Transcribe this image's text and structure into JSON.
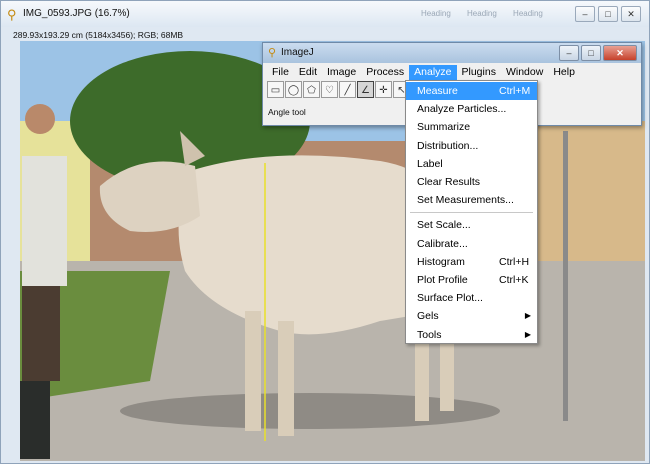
{
  "image_window": {
    "title": "IMG_0593.JPG (16.7%)",
    "info": "289.93x193.29 cm (5184x3456); RGB; 68MB",
    "blurred_tabs": "Heading   Heading   Heading",
    "controls": {
      "minimize": "–",
      "maximize": "□",
      "close": "✕"
    }
  },
  "imagej": {
    "title": "ImageJ",
    "controls": {
      "minimize": "–",
      "maximize": "□",
      "close": "✕"
    },
    "menus": [
      {
        "label": "File"
      },
      {
        "label": "Edit"
      },
      {
        "label": "Image"
      },
      {
        "label": "Process"
      },
      {
        "label": "Analyze"
      },
      {
        "label": "Plugins"
      },
      {
        "label": "Window"
      },
      {
        "label": "Help"
      }
    ],
    "active_menu": "Analyze",
    "tools": [
      {
        "icon": "rectangle-tool-icon",
        "glyph": "▭"
      },
      {
        "icon": "oval-tool-icon",
        "glyph": "◯"
      },
      {
        "icon": "polygon-tool-icon",
        "glyph": "⬠"
      },
      {
        "icon": "freehand-tool-icon",
        "glyph": "♡"
      },
      {
        "icon": "line-tool-icon",
        "glyph": "╱"
      },
      {
        "icon": "angle-tool-icon",
        "glyph": "∠"
      },
      {
        "icon": "point-tool-icon",
        "glyph": "✛"
      },
      {
        "icon": "wand-tool-icon",
        "glyph": "↖"
      },
      {
        "icon": "pencil-tool-icon",
        "glyph": "✎"
      },
      {
        "icon": "brush-tool-icon",
        "glyph": "🖌"
      },
      {
        "icon": "flood-fill-tool-icon",
        "glyph": "⛾"
      },
      {
        "icon": "more-tools-icon",
        "glyph": "»"
      }
    ],
    "selected_tool": "angle-tool-icon",
    "status": "Angle tool"
  },
  "analyze_menu": {
    "items": [
      {
        "label": "Measure",
        "shortcut": "Ctrl+M",
        "selected": true
      },
      {
        "label": "Analyze Particles...",
        "shortcut": ""
      },
      {
        "label": "Summarize",
        "shortcut": ""
      },
      {
        "label": "Distribution...",
        "shortcut": ""
      },
      {
        "label": "Label",
        "shortcut": ""
      },
      {
        "label": "Clear Results",
        "shortcut": ""
      },
      {
        "label": "Set Measurements...",
        "shortcut": ""
      },
      {
        "separator": true
      },
      {
        "label": "Set Scale...",
        "shortcut": ""
      },
      {
        "label": "Calibrate...",
        "shortcut": ""
      },
      {
        "label": "Histogram",
        "shortcut": "Ctrl+H"
      },
      {
        "label": "Plot Profile",
        "shortcut": "Ctrl+K"
      },
      {
        "label": "Surface Plot...",
        "shortcut": ""
      },
      {
        "label": "Gels",
        "shortcut": "",
        "submenu": true
      },
      {
        "label": "Tools",
        "shortcut": "",
        "submenu": true
      }
    ]
  },
  "colors": {
    "menu_highlight": "#3399ff",
    "measure_line": "#e8e02a",
    "sky": "#9cc3e6",
    "ground": "#b9b4ac"
  }
}
